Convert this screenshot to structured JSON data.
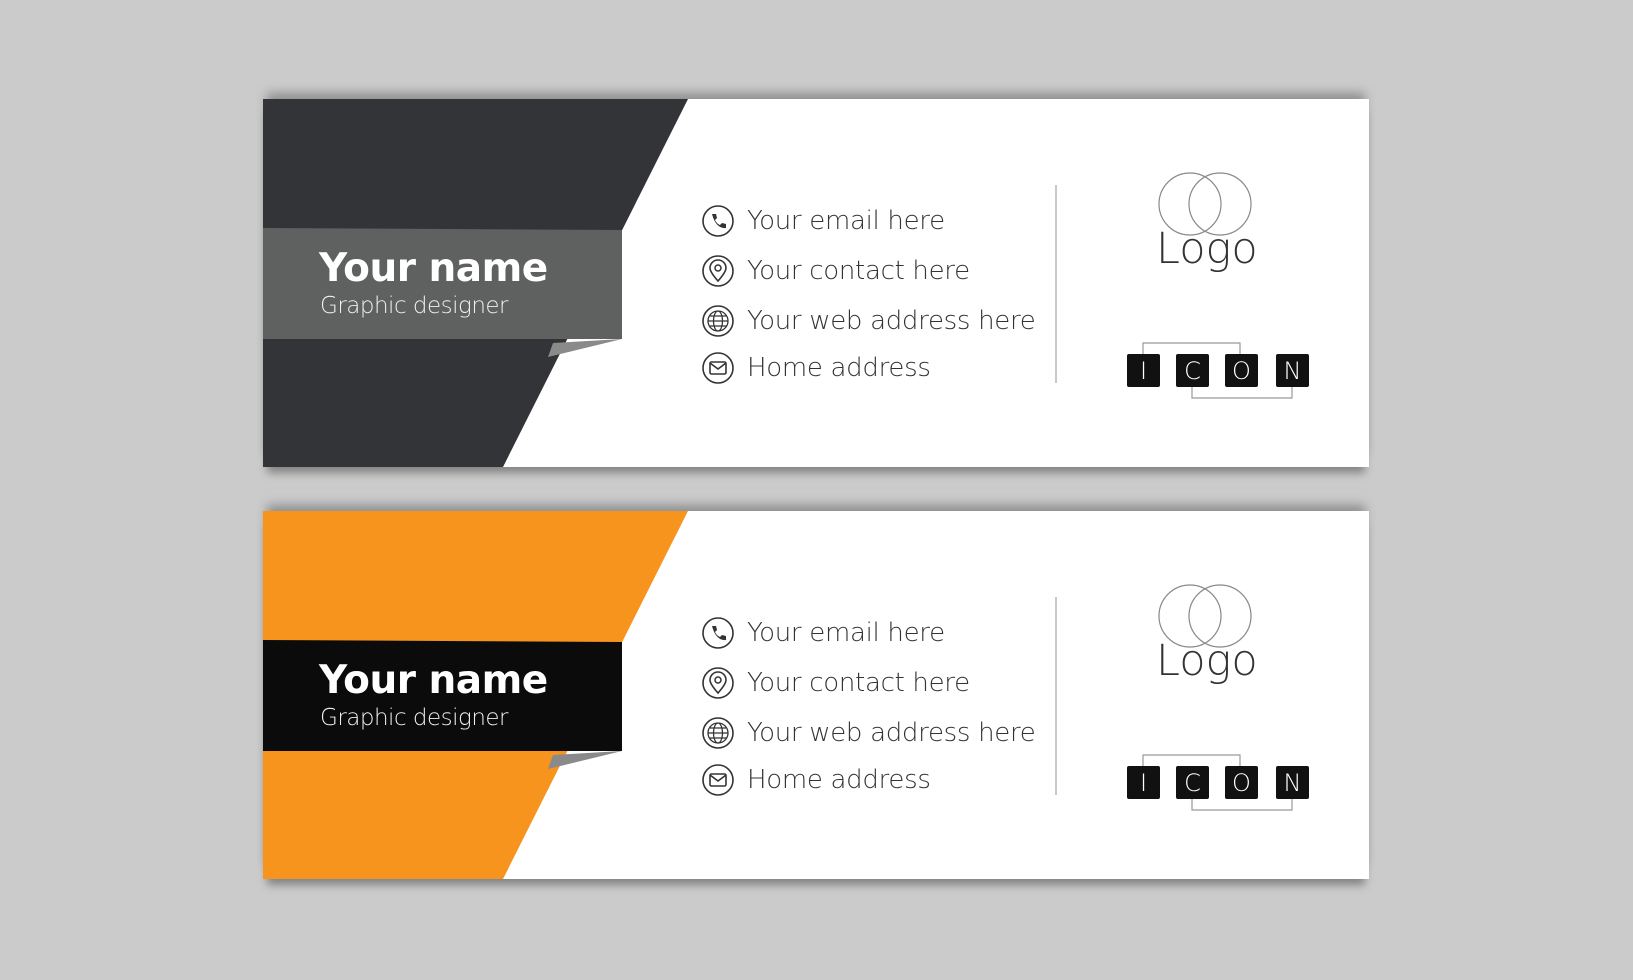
{
  "colors": {
    "background": "#cbcbcb",
    "dark_panel": "#333438",
    "gray_band": "#5f6060",
    "orange_panel": "#f7941d",
    "black_band": "#0b0b0b"
  },
  "cards": [
    {
      "name": "Your name",
      "role": "Graphic designer",
      "panel_color": "#333438",
      "band_color": "#5f6060",
      "contacts": [
        {
          "icon": "phone-icon",
          "text": "Your email here"
        },
        {
          "icon": "location-pin-icon",
          "text": "Your contact here"
        },
        {
          "icon": "globe-icon",
          "text": "Your web address here"
        },
        {
          "icon": "envelope-icon",
          "text": "Home address"
        }
      ],
      "logo_text": "Logo",
      "icon_letters": [
        "I",
        "C",
        "O",
        "N"
      ]
    },
    {
      "name": "Your name",
      "role": "Graphic designer",
      "panel_color": "#f7941d",
      "band_color": "#0b0b0b",
      "contacts": [
        {
          "icon": "phone-icon",
          "text": "Your email here"
        },
        {
          "icon": "location-pin-icon",
          "text": "Your contact here"
        },
        {
          "icon": "globe-icon",
          "text": "Your web address here"
        },
        {
          "icon": "envelope-icon",
          "text": "Home address"
        }
      ],
      "logo_text": "Logo",
      "icon_letters": [
        "I",
        "C",
        "O",
        "N"
      ]
    }
  ]
}
